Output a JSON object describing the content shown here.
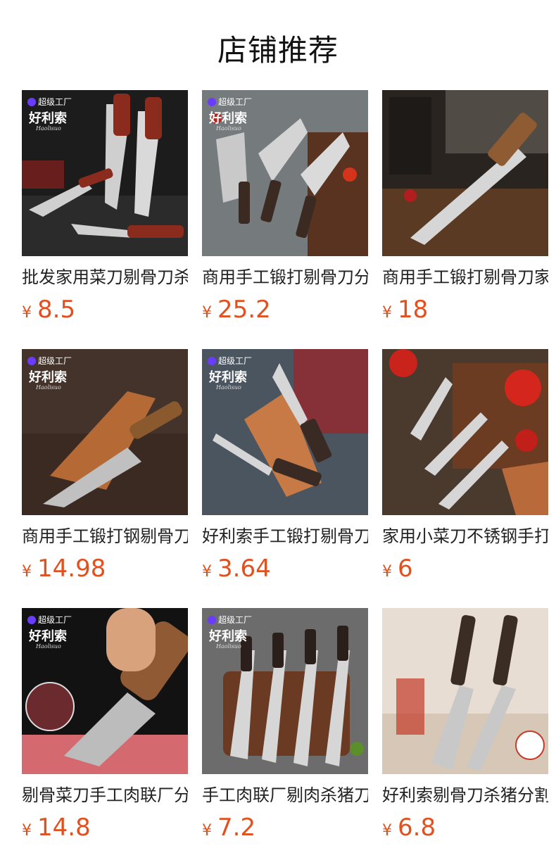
{
  "header": {
    "title": "店铺推荐"
  },
  "products": [
    {
      "title": "批发家用菜刀剔骨刀杀",
      "currency": "¥",
      "price": "8.5",
      "badge": "超级工厂",
      "brand": "好利索",
      "brand_sub": "Haolisuo",
      "image": "knife-product-image"
    },
    {
      "title": "商用手工锻打剔骨刀分",
      "currency": "¥",
      "price": "25.2",
      "badge": "超级工厂",
      "brand": "好利索",
      "brand_sub": "Haolisuo",
      "image": "knife-product-image"
    },
    {
      "title": "商用手工锻打剔骨刀家",
      "currency": "¥",
      "price": "18",
      "image": "knife-product-image"
    },
    {
      "title": "商用手工锻打钢剔骨刀",
      "currency": "¥",
      "price": "14.98",
      "badge": "超级工厂",
      "brand": "好利索",
      "brand_sub": "Haolisuo",
      "image": "knife-product-image"
    },
    {
      "title": "好利索手工锻打剔骨刀",
      "currency": "¥",
      "price": "3.64",
      "badge": "超级工厂",
      "brand": "好利索",
      "brand_sub": "Haolisuo",
      "image": "knife-product-image"
    },
    {
      "title": "家用小菜刀不锈钢手打",
      "currency": "¥",
      "price": "6",
      "image": "knife-product-image"
    },
    {
      "title": "剔骨菜刀手工肉联厂分",
      "currency": "¥",
      "price": "14.8",
      "badge": "超级工厂",
      "brand": "好利索",
      "brand_sub": "Haolisuo",
      "image": "knife-product-image"
    },
    {
      "title": "手工肉联厂剔肉杀猪刀",
      "currency": "¥",
      "price": "7.2",
      "badge": "超级工厂",
      "brand": "好利索",
      "brand_sub": "Haolisuo",
      "image": "knife-product-image"
    },
    {
      "title": "好利索剔骨刀杀猪分割",
      "currency": "¥",
      "price": "6.8",
      "image": "knife-product-image"
    }
  ],
  "colors": {
    "price": "#e2501f",
    "badge_dot": "#6a3cff"
  }
}
